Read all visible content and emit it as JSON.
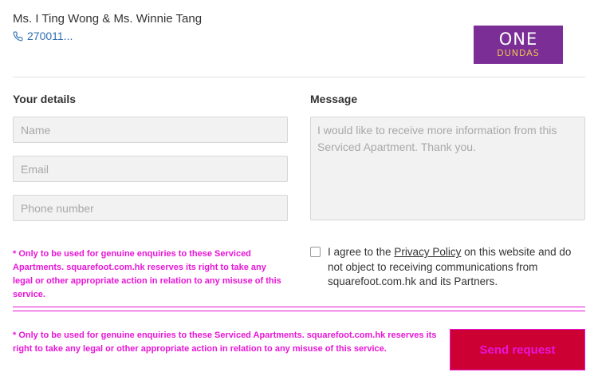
{
  "agent": {
    "name": "Ms. I Ting Wong & Ms. Winnie Tang",
    "phone": "270011..."
  },
  "logo": {
    "line1": "ONE",
    "line2": "DUNDAS",
    "bg_color": "#7b2f96"
  },
  "form": {
    "details_label": "Your details",
    "message_label": "Message",
    "name_placeholder": "Name",
    "email_placeholder": "Email",
    "phone_placeholder": "Phone number",
    "message_placeholder": "I would like to receive more information from this Serviced Apartment. Thank you."
  },
  "disclaimer_short": "* Only to be used for genuine enquiries to these Serviced Apartments. squarefoot.com.hk reserves its right to take any legal or other appropriate action in relation to any misuse of this service.",
  "disclaimer_long": "* Only to be used for genuine enquiries to these Serviced Apartments. squarefoot.com.hk reserves its right to take any legal or other appropriate action in relation to any misuse of this service.",
  "consent": {
    "checked": false,
    "prefix": "I agree to the ",
    "link_text": "Privacy Policy",
    "suffix": " on this website and do not object to receiving communications from squarefoot.com.hk and its Partners."
  },
  "send_button": "Send request",
  "colors": {
    "link_blue": "#2e6fb4",
    "warning_magenta": "#e815d6",
    "button_red": "#cc0033"
  }
}
